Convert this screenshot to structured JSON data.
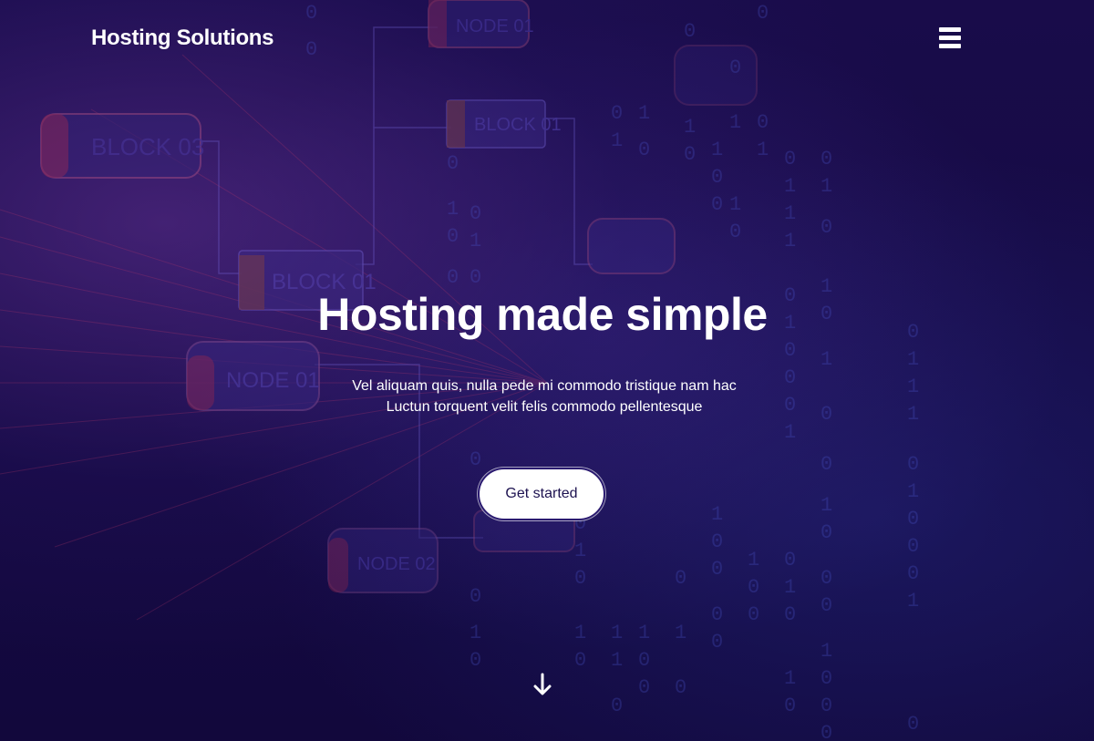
{
  "navbar": {
    "brand": "Hosting Solutions",
    "menu_icon": "hamburger-menu-icon"
  },
  "hero": {
    "title": "Hosting made simple",
    "subtitle": "Vel aliquam quis, nulla pede mi commodo tristique nam hac Luctun torquent velit felis commodo pellentesque",
    "cta_label": "Get started",
    "scroll_icon": "arrow-down-icon"
  },
  "background": {
    "labels": [
      "BLOCK 03",
      "BLOCK 01",
      "BLOCK 01",
      "NODE 01",
      "NODE 01",
      "NODE 02"
    ]
  },
  "colors": {
    "background": "#13083f",
    "text": "#ffffff",
    "button_bg": "#ffffff",
    "button_text": "#1d1250"
  }
}
